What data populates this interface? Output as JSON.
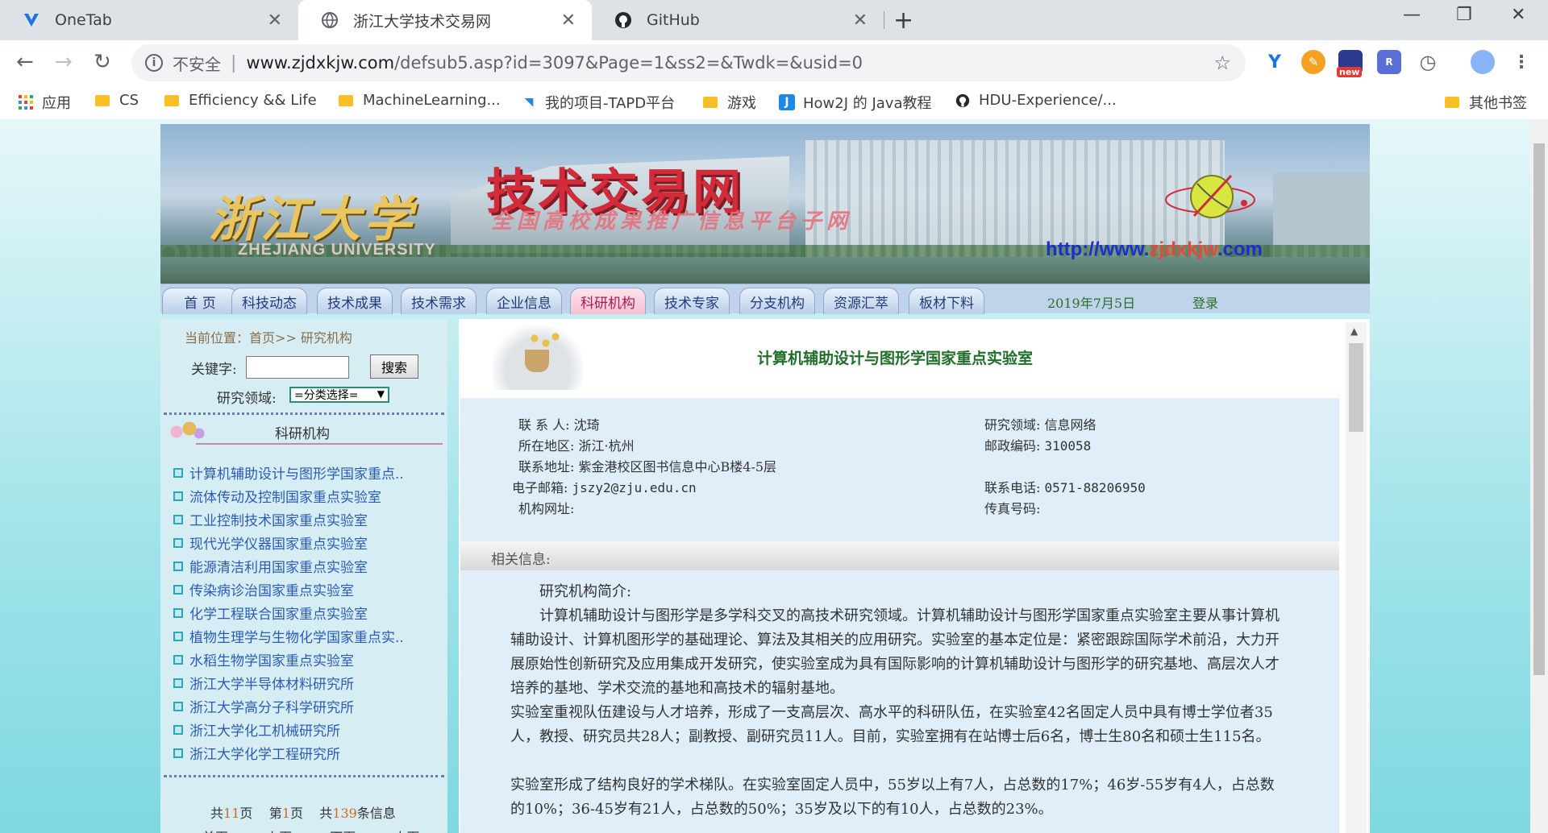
{
  "browser": {
    "tabs": [
      {
        "title": "OneTab"
      },
      {
        "title": "浙江大学技术交易网"
      },
      {
        "title": "GitHub"
      }
    ],
    "address": {
      "security_label": "不安全",
      "host": "www.zjdxkjw.com",
      "path": "/defsub5.asp?id=3097&Page=1&ss2=&Twdk=&usid=0"
    },
    "ext_new_badge": "new",
    "bookmarks": [
      {
        "label": "应用"
      },
      {
        "label": "CS"
      },
      {
        "label": "Efficiency && Life"
      },
      {
        "label": "MachineLearning..."
      },
      {
        "label": "我的项目-TAPD平台"
      },
      {
        "label": "游戏"
      },
      {
        "label": "How2J 的 Java教程"
      },
      {
        "label": "HDU-Experience/..."
      },
      {
        "label": "其他书签"
      }
    ]
  },
  "banner": {
    "logo_cn": "浙江大学",
    "logo_en": "ZHEJIANG UNIVERSITY",
    "title": "技术交易网",
    "subtitle": "全国高校成果推广信息平台子网",
    "url_prefix": "http://www.",
    "url_mid": "zjdxkjw",
    "url_suffix": ".com"
  },
  "nav": {
    "items": [
      "首 页",
      "科技动态",
      "技术成果",
      "技术需求",
      "企业信息",
      "科研机构",
      "技术专家",
      "分支机构",
      "资源汇萃",
      "板材下料"
    ],
    "active_index": 5,
    "date": "2019年7月5日",
    "login": "登录"
  },
  "sidebar": {
    "breadcrumb_prefix": "当前位置：首页>>",
    "breadcrumb_current": "研究机构",
    "keyword_label": "关键字:",
    "keyword_value": "",
    "search_button": "搜索",
    "field_label": "研究领域:",
    "field_select": "=分类选择=",
    "section_title": "科研机构",
    "institutions": [
      "计算机辅助设计与图形学国家重点..",
      "流体传动及控制国家重点实验室",
      "工业控制技术国家重点实验室",
      "现代光学仪器国家重点实验室",
      "能源清洁利用国家重点实验室",
      "传染病诊治国家重点实验室",
      "化学工程联合国家重点实验室",
      "植物生理学与生物化学国家重点实..",
      "水稻生物学国家重点实验室",
      "浙江大学半导体材料研究所",
      "浙江大学高分子科学研究所",
      "浙江大学化工机械研究所",
      "浙江大学化学工程研究所"
    ],
    "pager": {
      "total_pages_pre": "共",
      "total_pages": "11",
      "total_pages_post": "页",
      "current_pre": "第",
      "current": "1",
      "current_post": "页",
      "total_items_pre": "共",
      "total_items": "139",
      "total_items_post": "条信息",
      "first": "首页",
      "prev": "上页",
      "next": "下页",
      "last": "末页"
    }
  },
  "lab": {
    "title": "计算机辅助设计与图形学国家重点实验室",
    "contact_label": "联 系 人:",
    "contact": "沈琦",
    "region_label": "所在地区:",
    "region": "浙江·杭州",
    "address_label": "联系地址:",
    "address": "紫金港校区图书信息中心B楼4-5层",
    "email_label": "电子邮箱:",
    "email": "jszy2@zju.edu.cn",
    "website_label": "机构网址:",
    "website": "",
    "field_label": "研究领域:",
    "field": "信息网络",
    "postcode_label": "邮政编码:",
    "postcode": "310058",
    "phone_label": "联系电话:",
    "phone": "0571-88206950",
    "fax_label": "传真号码:",
    "fax": "",
    "related_label": "相关信息:",
    "intro_label": "研究机构简介:",
    "paragraphs": [
      "计算机辅助设计与图形学是多学科交叉的高技术研究领域。计算机辅助设计与图形学国家重点实验室主要从事计算机辅助设计、计算机图形学的基础理论、算法及其相关的应用研究。实验室的基本定位是：紧密跟踪国际学术前沿，大力开展原始性创新研究及应用集成开发研究，使实验室成为具有国际影响的计算机辅助设计与图形学的研究基地、高层次人才培养的基地、学术交流的基地和高技术的辐射基地。",
      "实验室重视队伍建设与人才培养，形成了一支高层次、高水平的科研队伍，在实验室42名固定人员中具有博士学位者35人，教授、研究员共28人；副教授、副研究员11人。目前，实验室拥有在站博士后6名，博士生80名和硕士生115名。",
      "实验室形成了结构良好的学术梯队。在实验室固定人员中，55岁以上有7人，占总数的17%；46岁-55岁有4人，占总数的10%；36-45岁有21人，占总数的50%；35岁及以下的有10人，占总数的23%。"
    ]
  }
}
